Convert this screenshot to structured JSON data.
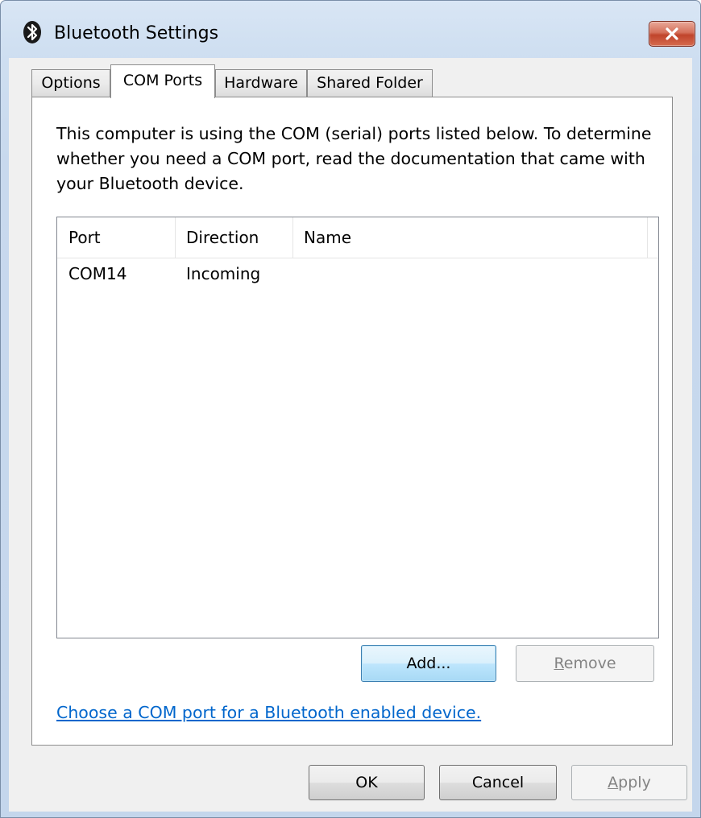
{
  "window": {
    "title": "Bluetooth Settings"
  },
  "tabs": [
    {
      "label": "Options"
    },
    {
      "label": "COM Ports"
    },
    {
      "label": "Hardware"
    },
    {
      "label": "Shared Folder"
    }
  ],
  "active_tab": "COM Ports",
  "description": "This computer is using the COM (serial) ports listed below. To determine whether you need a COM port, read the documentation that came with your Bluetooth device.",
  "ports_table": {
    "columns": [
      "Port",
      "Direction",
      "Name"
    ],
    "rows": [
      {
        "port": "COM14",
        "direction": "Incoming",
        "name": ""
      }
    ]
  },
  "buttons": {
    "add": "Add...",
    "remove_prefix": "",
    "remove_mnemonic": "R",
    "remove_rest": "emove",
    "ok": "OK",
    "cancel": "Cancel",
    "apply_mnemonic": "A",
    "apply_rest": "pply"
  },
  "link": "Choose a COM port for a Bluetooth enabled device.",
  "icons": {
    "title": "bluetooth-icon",
    "close": "close-icon"
  },
  "colors": {
    "close_button": "#c0442b",
    "link": "#0066cc",
    "default_button_border": "#3c7fb1"
  }
}
